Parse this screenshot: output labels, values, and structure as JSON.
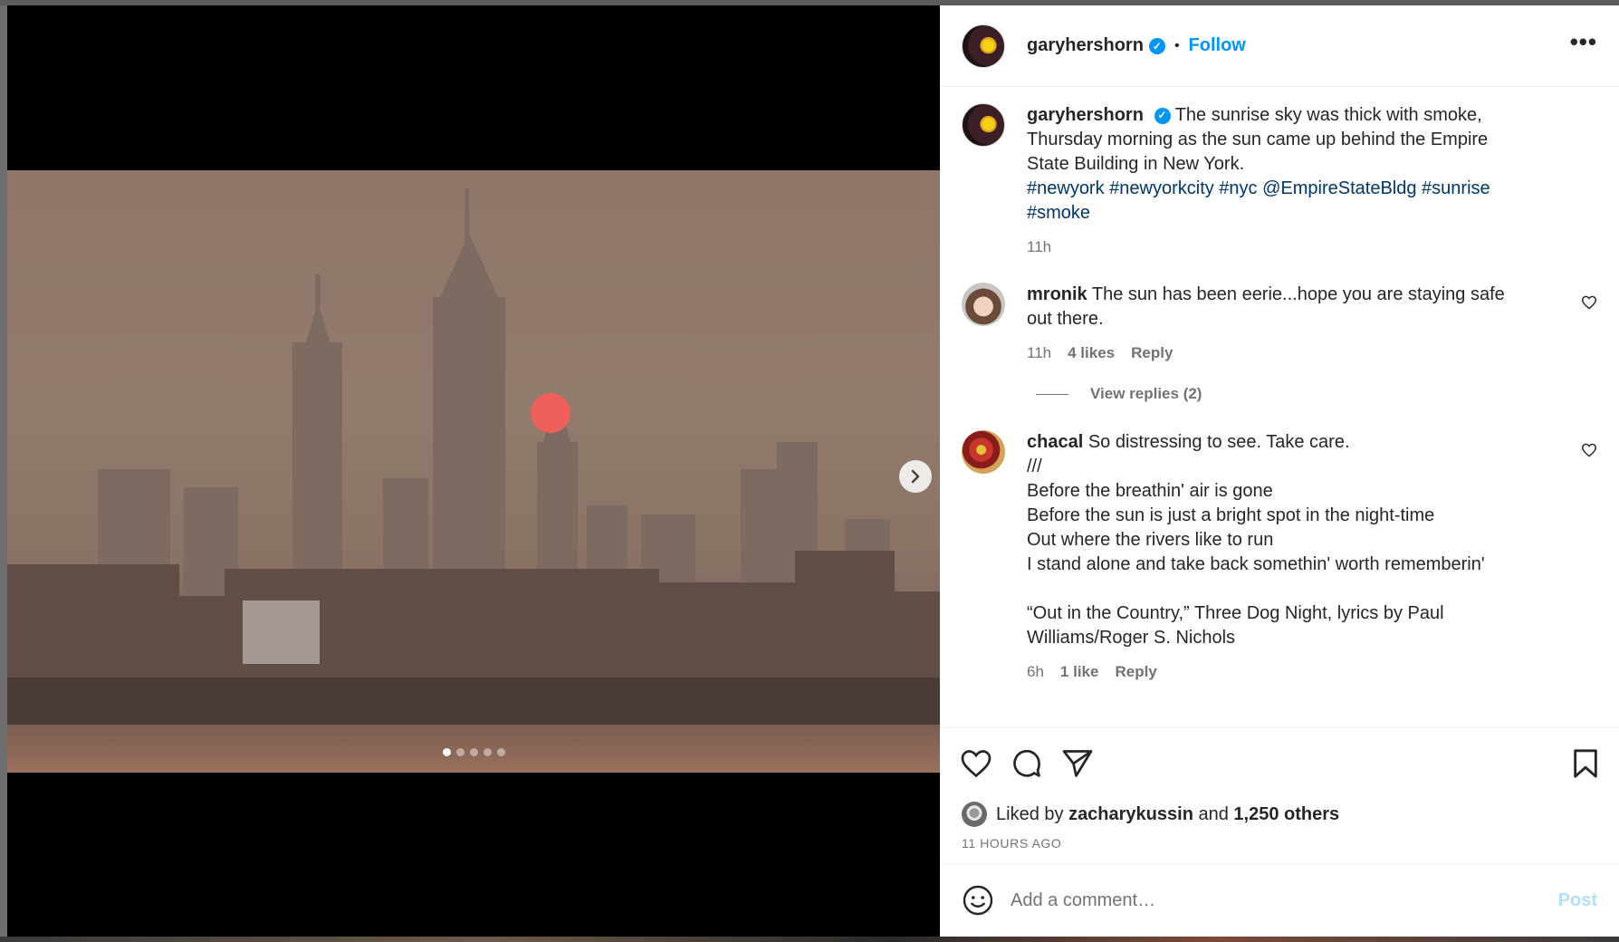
{
  "post": {
    "author": "garyhershorn",
    "follow_label": "Follow",
    "separator": "•",
    "more_label": "•••",
    "caption": {
      "text": "The sunrise sky was thick with smoke, Thursday morning as the sun came up behind the Empire State Building in New York.",
      "tags": "#newyork #newyorkcity #nyc @EmpireStateBldg #sunrise #smoke",
      "time": "11h"
    },
    "media": {
      "slide_count": 5,
      "active_slide": 1
    }
  },
  "comments": [
    {
      "user": "mronik",
      "text": "The sun has been eerie...hope you are staying safe out there.",
      "time": "11h",
      "likes": "4 likes",
      "reply": "Reply",
      "view_replies": "View replies (2)"
    },
    {
      "user": "chacal",
      "text_lines": [
        "So distressing to see. Take care.",
        "///",
        "Before the breathin' air is gone",
        "Before the sun is just a bright spot in the night-time",
        "Out where the rivers like to run",
        "I stand alone and take back somethin' worth rememberin'",
        "",
        "“Out in the Country,” Three Dog Night, lyrics by Paul Williams/Roger S. Nichols"
      ],
      "time": "6h",
      "likes": "1 like",
      "reply": "Reply"
    }
  ],
  "likes": {
    "prefix": "Liked by",
    "user": "zacharykussin",
    "joiner": "and",
    "others": "1,250 others",
    "time_ago": "11 HOURS AGO"
  },
  "composer": {
    "placeholder": "Add a comment…",
    "post_label": "Post"
  },
  "colors": {
    "accent": "#0095f6",
    "tag": "#00376b",
    "muted": "#737373",
    "sun": "#f0605a"
  },
  "icons": [
    "verified-badge-icon",
    "more-options-icon",
    "chevron-right-icon",
    "heart-icon",
    "comment-icon",
    "share-icon",
    "bookmark-icon",
    "emoji-icon"
  ]
}
